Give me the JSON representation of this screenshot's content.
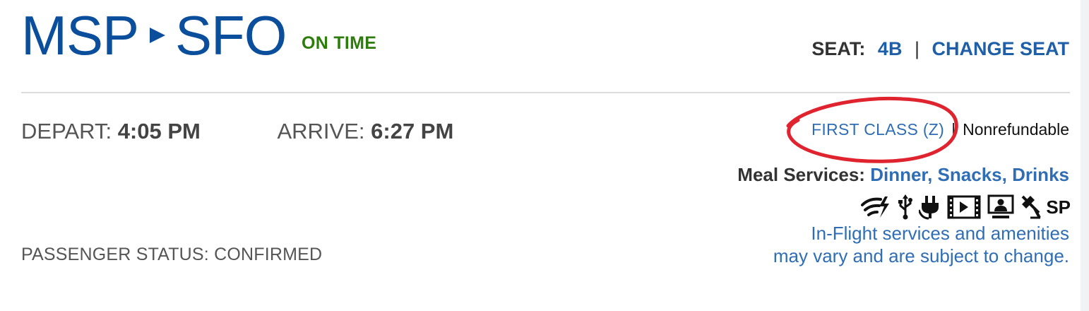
{
  "route": {
    "origin": "MSP",
    "destination": "SFO",
    "status": "ON TIME"
  },
  "seat": {
    "label": "SEAT:",
    "number": "4B",
    "separator": "|",
    "change_label": "CHANGE SEAT"
  },
  "times": {
    "depart_label": "DEPART:",
    "depart_value": "4:05 PM",
    "arrive_label": "ARRIVE:",
    "arrive_value": "6:27 PM"
  },
  "fare": {
    "class": "FIRST CLASS (Z)",
    "separator": "|",
    "refundability": "Nonrefundable"
  },
  "meal": {
    "label": "Meal Services:",
    "value": "Dinner, Snacks, Drinks"
  },
  "amenities": [
    {
      "icon": "wifi-icon"
    },
    {
      "icon": "usb-icon"
    },
    {
      "icon": "power-outlet-icon"
    },
    {
      "icon": "video-icon"
    },
    {
      "icon": "personal-screen-icon"
    },
    {
      "icon": "satellite-icon"
    },
    {
      "icon": "sp-label-icon",
      "text": "SP"
    }
  ],
  "disclaimer": {
    "line1": "In-Flight services and amenities",
    "line2": "may vary and are subject to change."
  },
  "passenger_status": "PASSENGER STATUS: CONFIRMED",
  "colors": {
    "primary_blue": "#0b4f9c",
    "link_blue": "#2f6db5",
    "status_green": "#2e7d0c",
    "annotation_red": "#e0242f"
  }
}
